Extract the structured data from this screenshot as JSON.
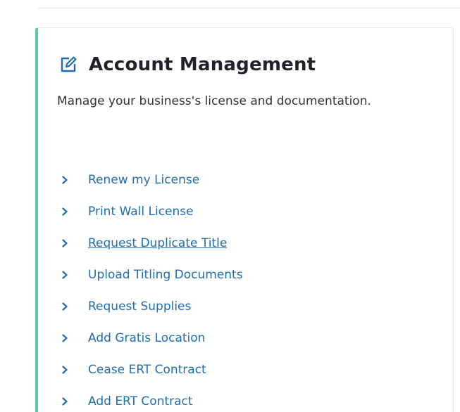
{
  "card": {
    "title": "Account Management",
    "description": "Manage your business's license and documentation.",
    "header_icon": "edit-icon",
    "accent_color": "#5fc7a6",
    "link_color": "#1e6db1"
  },
  "links": [
    {
      "label": "Renew my License",
      "icon": "chevron-right-icon",
      "hovered": false
    },
    {
      "label": "Print Wall License",
      "icon": "chevron-right-icon",
      "hovered": false
    },
    {
      "label": "Request Duplicate Title",
      "icon": "chevron-right-icon",
      "hovered": true
    },
    {
      "label": "Upload Titling Documents",
      "icon": "chevron-right-icon",
      "hovered": false
    },
    {
      "label": "Request Supplies",
      "icon": "chevron-right-icon",
      "hovered": false
    },
    {
      "label": "Add Gratis Location",
      "icon": "chevron-right-icon",
      "hovered": false
    },
    {
      "label": "Cease ERT Contract",
      "icon": "chevron-right-icon",
      "hovered": false
    },
    {
      "label": "Add ERT Contract",
      "icon": "chevron-right-icon",
      "hovered": false
    }
  ]
}
